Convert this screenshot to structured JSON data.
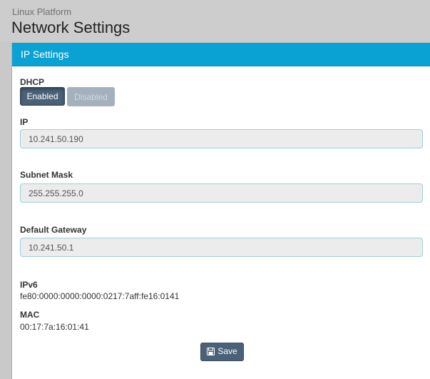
{
  "header": {
    "subtitle": "Linux Platform",
    "title": "Network Settings"
  },
  "panel": {
    "title": "IP Settings"
  },
  "dhcp": {
    "label": "DHCP",
    "enabled_label": "Enabled",
    "disabled_label": "Disabled",
    "selected": "Enabled"
  },
  "ip": {
    "label": "IP",
    "value": "10.241.50.190"
  },
  "subnet": {
    "label": "Subnet Mask",
    "value": "255.255.255.0"
  },
  "gateway": {
    "label": "Default Gateway",
    "value": "10.241.50.1"
  },
  "ipv6": {
    "label": "IPv6",
    "value": "fe80:0000:0000:0000:0217:7aff:fe16:0141"
  },
  "mac": {
    "label": "MAC",
    "value": "00:17:7a:16:01:41"
  },
  "save": {
    "label": "Save",
    "icon": "floppy-disk-icon"
  },
  "colors": {
    "panel_heading": "#0aa1d3",
    "button_primary": "#4b6178",
    "button_disabled": "#a4b0bc",
    "input_border": "#9ccfdd"
  }
}
